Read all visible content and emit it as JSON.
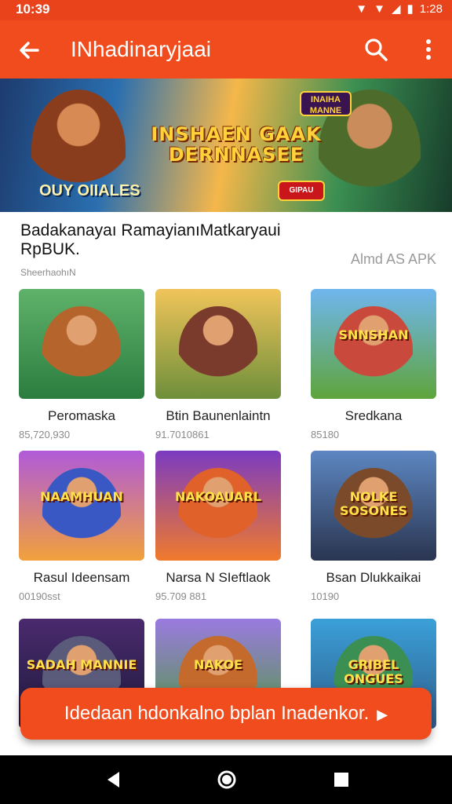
{
  "status_bar": {
    "time": "10:39",
    "right_time": "1:28"
  },
  "app_bar": {
    "title": "INhadinaryjaai"
  },
  "banner": {
    "headline": "INSHAEN GAAK DERNNASEE",
    "subtitle": "OUY OIIALES",
    "badge_top": "INAIHA MANNE",
    "badge_bottom": "GIPAU"
  },
  "info": {
    "title": "Badakanayaı RamayianıMatkaryaui RpBUK.",
    "meta": "SheerhaohıN",
    "apk_link": "Almd AS APK"
  },
  "games": [
    {
      "name": "Peromaska",
      "count": "85,720,930",
      "colors": [
        "#5fb26a",
        "#2b7d3f"
      ],
      "fig": "#b5652b",
      "caption": ""
    },
    {
      "name": "Btin Baunenlaintn",
      "count": "91.7010861",
      "colors": [
        "#f0c45a",
        "#6e8f3a"
      ],
      "fig": "#7a3b2d",
      "caption": ""
    },
    {
      "name": "Sredkana",
      "count": "85180",
      "colors": [
        "#6fb6ef",
        "#5fa43b"
      ],
      "fig": "#c94a3c",
      "caption": "SNNSHAN"
    },
    {
      "name": "Rasul Ideensam",
      "count": "00190sst",
      "colors": [
        "#b05ad9",
        "#f2a13c"
      ],
      "fig": "#3a58c4",
      "caption": "NAAMHUAN"
    },
    {
      "name": "Narsa N SIeftlaok",
      "count": "95.709 881",
      "colors": [
        "#7b3bc2",
        "#f07a2c"
      ],
      "fig": "#e0622a",
      "caption": "NAKOAUARL"
    },
    {
      "name": "Bsan Dlukkaikai",
      "count": "10190",
      "colors": [
        "#5d87c2",
        "#2a3550"
      ],
      "fig": "#7a4a2a",
      "caption": "NOLKE SOSONES"
    },
    {
      "name": "",
      "count": "",
      "colors": [
        "#4a2a6e",
        "#1c1a3a"
      ],
      "fig": "#5a5a7a",
      "caption": "SADAH MANNIE"
    },
    {
      "name": "",
      "count": "",
      "colors": [
        "#9a7ae0",
        "#4f9b3e"
      ],
      "fig": "#c46a2d",
      "caption": "NAKOE"
    },
    {
      "name": "",
      "count": "",
      "colors": [
        "#3aa0d8",
        "#2f5c8a"
      ],
      "fig": "#3b8f52",
      "caption": "GRIBEL ONGUES"
    }
  ],
  "cta": {
    "label": "Idedaan hdonkalno bplan Inadenkor."
  }
}
